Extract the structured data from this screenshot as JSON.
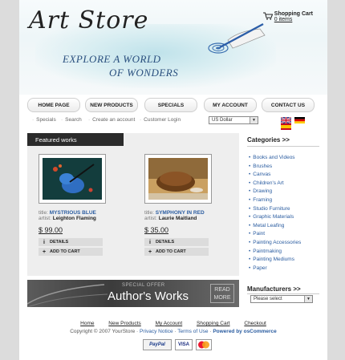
{
  "header": {
    "logo": "Art Store",
    "tagline_line1": "EXPLORE A WORLD",
    "tagline_line2": "OF WONDERS",
    "cart_title": "Shopping Cart",
    "cart_items": "0 items"
  },
  "nav": {
    "items": [
      "HOME PAGE",
      "NEW PRODUCTS",
      "SPECIALS",
      "MY ACCOUNT",
      "CONTACT US"
    ]
  },
  "subbar": {
    "links": [
      "Specials",
      "Search",
      "Create an account",
      "Customer Login"
    ],
    "currency": "US Dollar",
    "flags": [
      "english-flag-icon",
      "german-flag-icon",
      "spanish-flag-icon"
    ]
  },
  "featured": {
    "tab_label": "Featured works",
    "products": [
      {
        "title_label": "title:",
        "title": "MYSTRIOUS BLUE",
        "artist_label": "artist:",
        "artist": "Leighton Flaming",
        "price": "$ 99.00",
        "details": "DETAILS",
        "add_to_cart": "ADD TO CART"
      },
      {
        "title_label": "title:",
        "title": "SYMPHONY IN RED",
        "artist_label": "artist:",
        "artist": "Laurie Maitland",
        "price": "$ 35.00",
        "details": "DETAILS",
        "add_to_cart": "ADD TO CART"
      }
    ]
  },
  "banner": {
    "special": "SPECIAL OFFER",
    "title": "Author's Works",
    "read_more_1": "READ",
    "read_more_2": "MORE"
  },
  "categories": {
    "title": "Categories  >>",
    "items": [
      "Books and Videos",
      "Brushes",
      "Canvas",
      "Children's Art",
      "Drawing",
      "Framing",
      "Studio Furniture",
      "Graphic Materials",
      "Metal Leafing",
      "Paint",
      "Painting Accessories",
      "Paintmaking",
      "Painting Mediums",
      "Paper"
    ]
  },
  "manufacturers": {
    "title": "Manufacturers  >>",
    "select_value": "Please select"
  },
  "footer": {
    "links": [
      "Home",
      "New Products",
      "My Account",
      "Shopping Cart",
      "Checkout"
    ],
    "copyright": "Copyright © 2007 YourStore",
    "privacy": "Privacy Notice",
    "terms": "Terms of Use",
    "powered": "Powered by osCommerce",
    "payments": [
      "PayPal",
      "VISA",
      "MasterCard"
    ]
  },
  "colors": {
    "link_blue": "#2a5ca0",
    "tab_dark": "#2b2b2b"
  }
}
